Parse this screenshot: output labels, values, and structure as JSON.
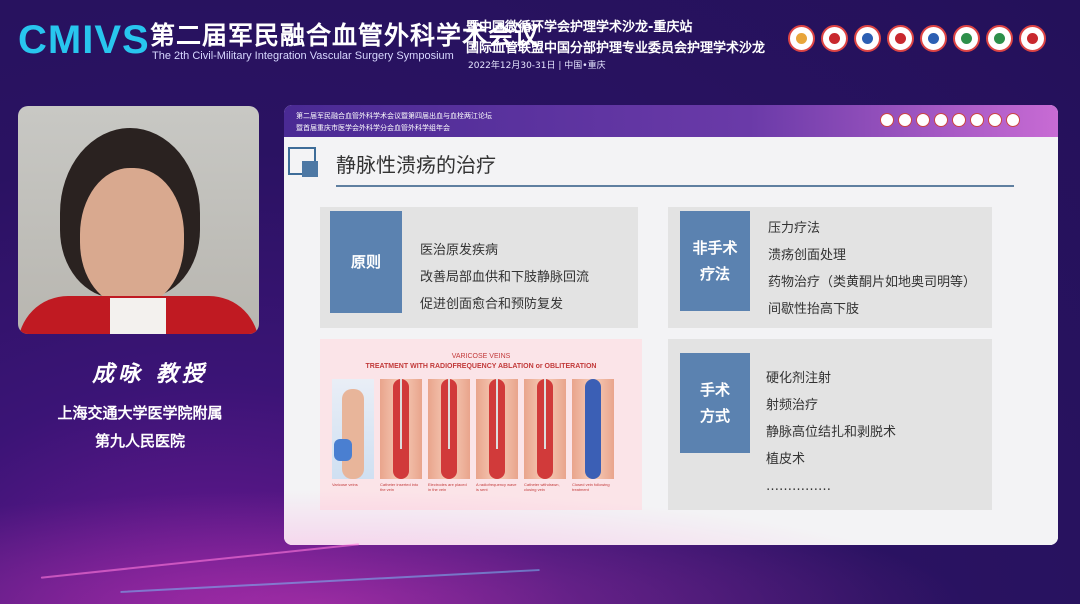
{
  "header": {
    "logo": "CMIVS",
    "title_cn": "第二届军民融合血管外科学术会议",
    "title_en": "The 2th Civil-Military Integration Vascular Surgery Symposium",
    "subtitle_line1": "暨中国微循环学会护理学术沙龙-重庆站",
    "subtitle_line2": "国际血管联盟中国分部护理专业委员会护理学术沙龙",
    "date_place": "2022年12月30-31日 | 中国•重庆",
    "badge_colors": [
      "#e8a53a",
      "#c8282e",
      "#2c5fb3",
      "#c8282e",
      "#2c5fb3",
      "#2d8f4a",
      "#2d8f4a",
      "#c8282e"
    ]
  },
  "presenter": {
    "name": "成咏  教授",
    "affiliation_line1": "上海交通大学医学院附属",
    "affiliation_line2": "第九人民医院"
  },
  "slide": {
    "banner_line1": "第二届军民融合血管外科学术会议暨第四届出血与血栓两江论坛",
    "banner_line2": "暨首届重庆市医学会外科学分会血管外科学组年会",
    "title": "静脉性溃疡的治疗",
    "principle": {
      "tag": "原则",
      "items": [
        "医治原发疾病",
        "改善局部血供和下肢静脉回流",
        "促进创面愈合和预防复发"
      ]
    },
    "non_surgical": {
      "tag_line1": "非手术",
      "tag_line2": "疗法",
      "items": [
        "压力疗法",
        "溃疡创面处理",
        "药物治疗（类黄酮片如地奥司明等）",
        "间歇性抬高下肢"
      ]
    },
    "surgical": {
      "tag_line1": "手术",
      "tag_line2": "方式",
      "items": [
        "硬化剂注射",
        "射频治疗",
        "静脉高位结扎和剥脱术",
        "植皮术",
        "……………"
      ]
    },
    "figure": {
      "title": "VARICOSE VEINS",
      "subtitle": "TREATMENT WITH RADIOFREQUENCY ABLATION or OBLITERATION",
      "captions": [
        "Varicose veins",
        "Catheter inserted into the vein",
        "Electrodes are placed in the vein",
        "A radiofrequency wave is sent",
        "Catheter withdrawn, closing vein",
        "Closed vein following treatment"
      ]
    }
  }
}
